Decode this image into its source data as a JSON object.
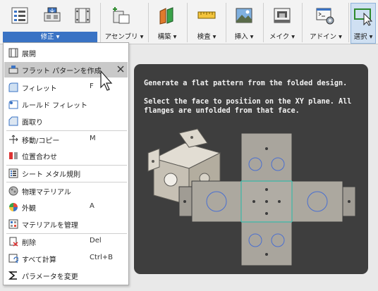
{
  "ribbon": {
    "groups": [
      {
        "label": "修正 ▾",
        "icon": "modify-icon"
      },
      {
        "label": "アセンブリ ▾",
        "icon": "assembly-icon"
      },
      {
        "label": "構築 ▾",
        "icon": "construct-icon"
      },
      {
        "label": "検査 ▾",
        "icon": "inspect-icon"
      },
      {
        "label": "挿入 ▾",
        "icon": "insert-icon"
      },
      {
        "label": "メイク ▾",
        "icon": "make-icon"
      },
      {
        "label": "アドイン ▾",
        "icon": "addins-icon"
      },
      {
        "label": "選択 ▾",
        "icon": "select-icon"
      }
    ],
    "active_color": "#3a73c4"
  },
  "menu": {
    "items": [
      {
        "label": "展開",
        "icon": "unfold-icon",
        "shortcut": ""
      },
      {
        "label": "フラット パターンを作成",
        "icon": "flat-pattern-icon",
        "shortcut": "",
        "highlighted": true
      },
      {
        "label": "フィレット",
        "icon": "fillet-icon",
        "shortcut": "F"
      },
      {
        "label": "ルールド フィレット",
        "icon": "rule-fillet-icon",
        "shortcut": ""
      },
      {
        "label": "面取り",
        "icon": "chamfer-icon",
        "shortcut": ""
      },
      {
        "label": "移動/コピー",
        "icon": "move-icon",
        "shortcut": "M"
      },
      {
        "label": "位置合わせ",
        "icon": "align-icon",
        "shortcut": ""
      },
      {
        "label": "シート メタル規則",
        "icon": "sheet-metal-rules-icon",
        "shortcut": ""
      },
      {
        "label": "物理マテリアル",
        "icon": "physical-material-icon",
        "shortcut": ""
      },
      {
        "label": "外観",
        "icon": "appearance-icon",
        "shortcut": "A"
      },
      {
        "label": "マテリアルを管理",
        "icon": "manage-materials-icon",
        "shortcut": ""
      },
      {
        "label": "削除",
        "icon": "delete-icon",
        "shortcut": "Del"
      },
      {
        "label": "すべて計算",
        "icon": "compute-all-icon",
        "shortcut": "Ctrl+B"
      },
      {
        "label": "パラメータを変更",
        "icon": "parameters-icon",
        "shortcut": ""
      }
    ]
  },
  "tooltip": {
    "line1": "Generate a flat pattern from the folded design.",
    "line2": "Select the face to position on the XY plane. All",
    "line3": "flanges are unfolded from that face."
  }
}
